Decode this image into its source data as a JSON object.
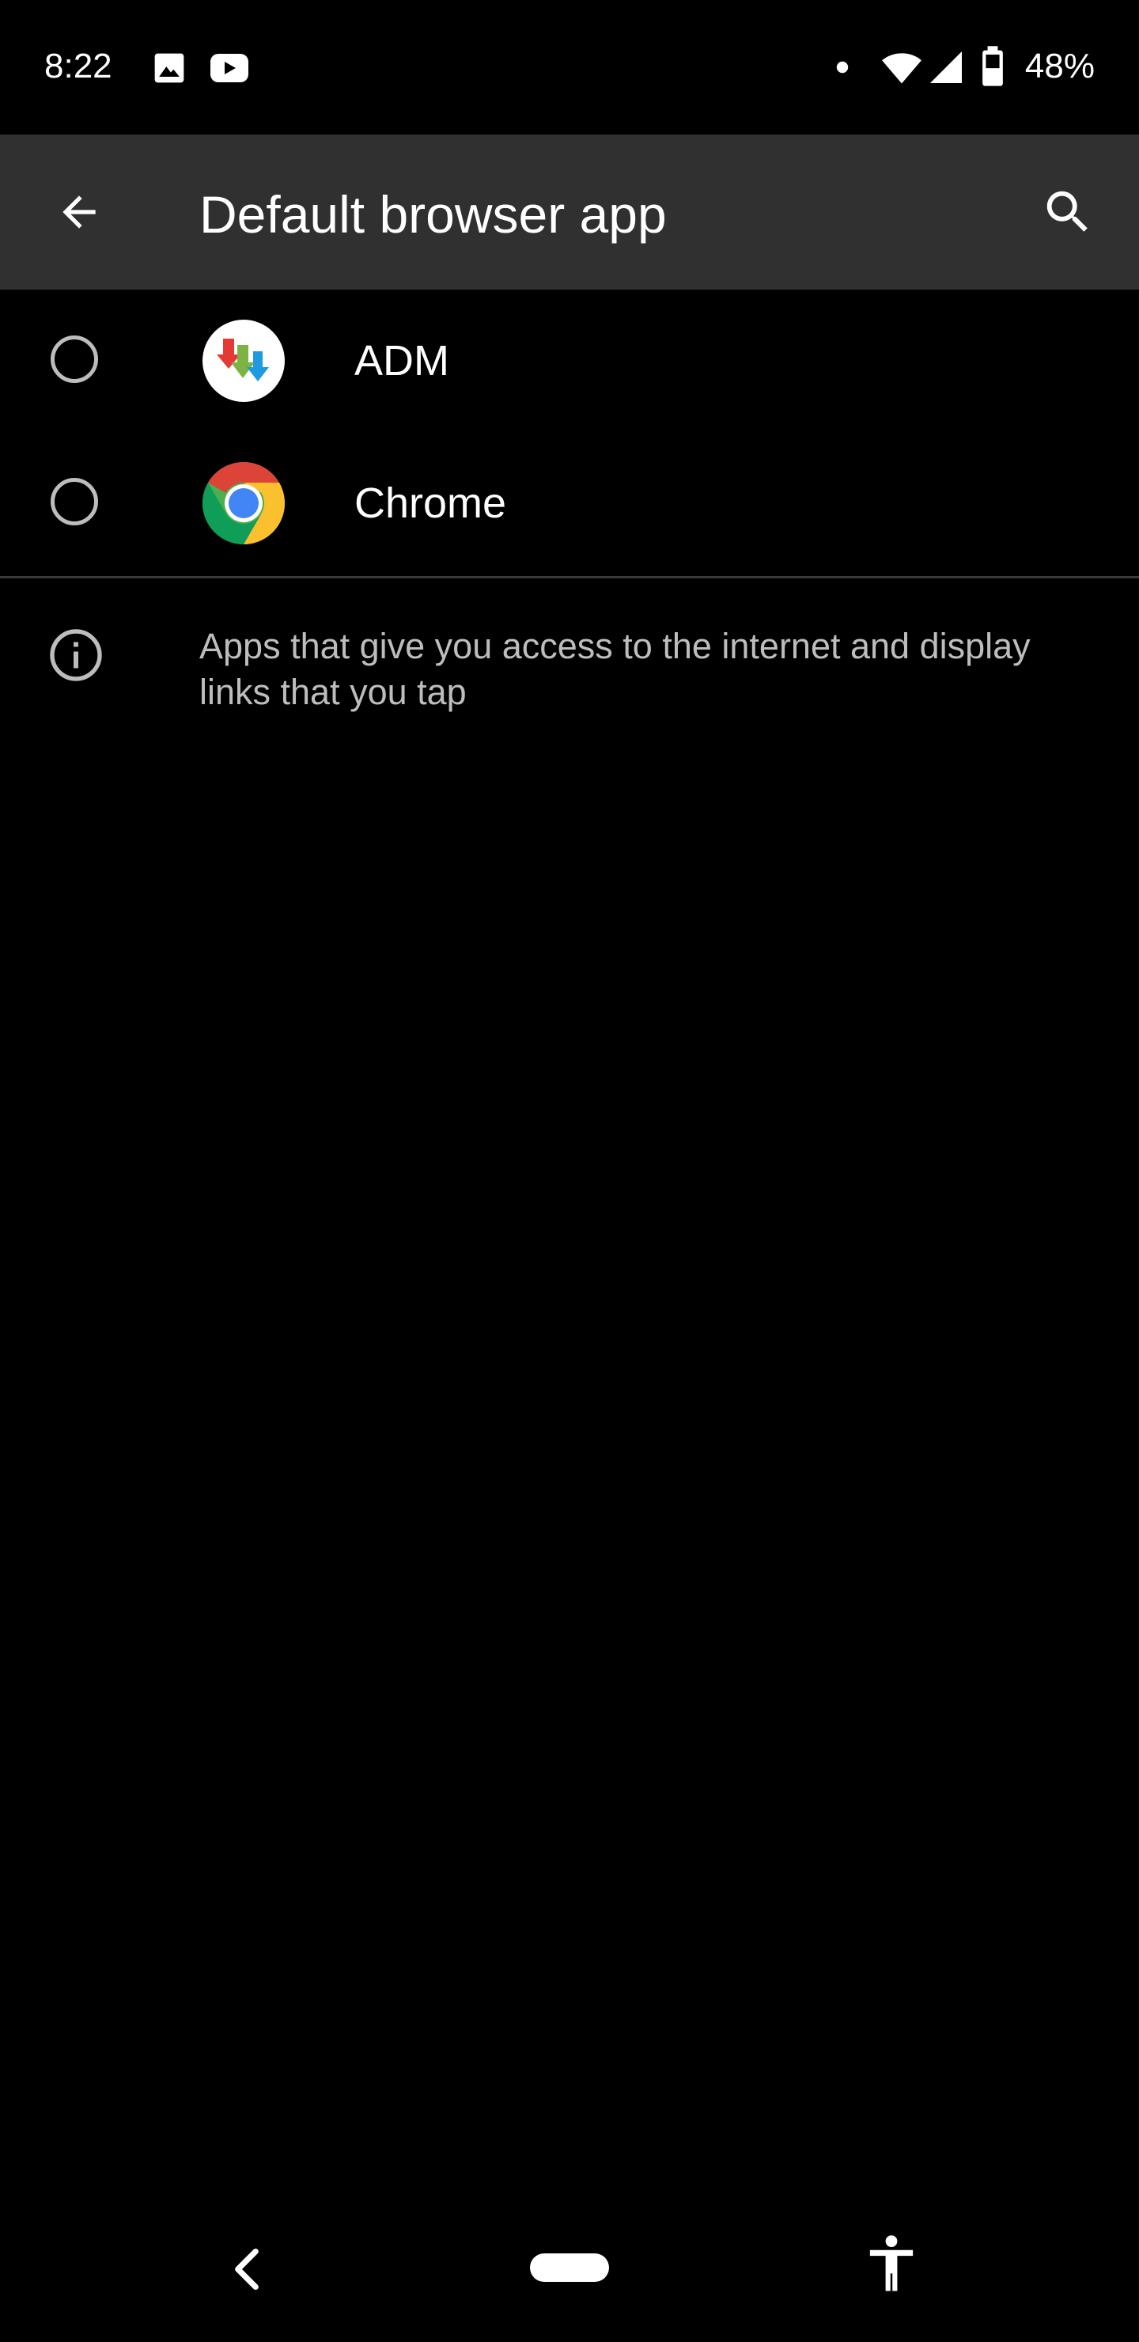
{
  "status_bar": {
    "time": "8:22",
    "battery_percent": "48%",
    "icons": [
      "image-icon",
      "youtube-icon",
      "notification-dot-icon",
      "wifi-icon",
      "cell-signal-icon",
      "battery-icon"
    ]
  },
  "app_bar": {
    "title": "Default browser app",
    "back_icon": "back-arrow-icon",
    "search_icon": "search-icon"
  },
  "apps": [
    {
      "label": "ADM",
      "icon": "adm-app-icon",
      "selected": false
    },
    {
      "label": "Chrome",
      "icon": "chrome-app-icon",
      "selected": false
    }
  ],
  "info": {
    "icon": "info-icon",
    "text": "Apps that give you access to the internet and display links that you tap"
  },
  "nav_bar": {
    "buttons": [
      "nav-back-icon",
      "home-pill",
      "accessibility-icon"
    ]
  },
  "colors": {
    "background": "#000000",
    "app_bar": "#303030",
    "secondary_text": "#bdbdbd",
    "divider": "#3a3a3a"
  }
}
